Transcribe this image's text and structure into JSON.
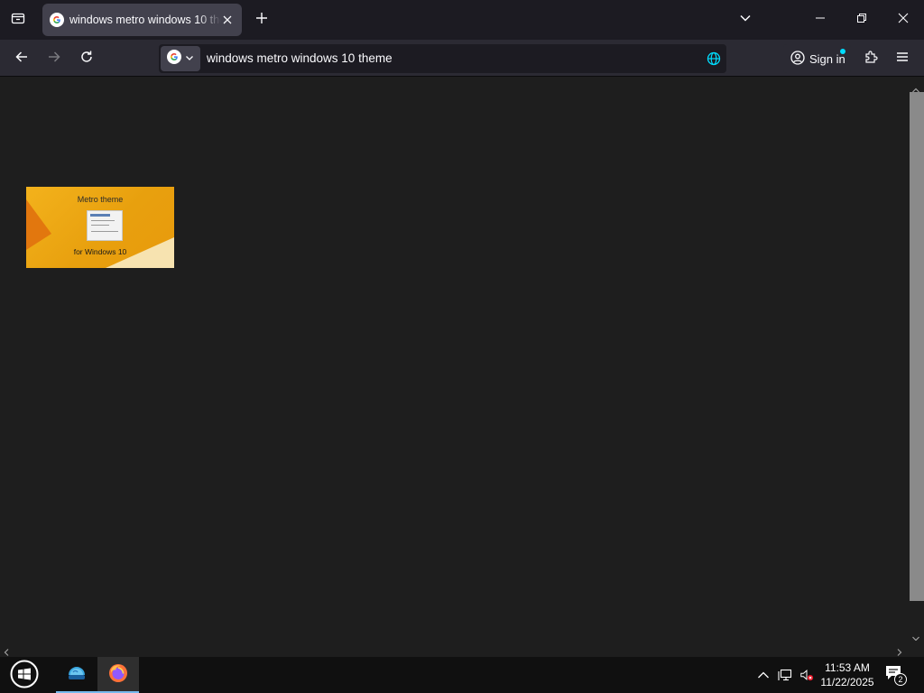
{
  "browser": {
    "tab": {
      "title": "windows metro windows 10 theme",
      "favicon": "google-g-icon"
    },
    "urlbar": {
      "value": "windows metro windows 10 theme",
      "search_engine": "google-g-icon"
    },
    "signin_label": "Sign in",
    "colors": {
      "tab_active": "#42414d",
      "toolbar": "#2b2a33",
      "urlbar": "#1c1b22",
      "accent": "#00ddff"
    }
  },
  "content": {
    "image_result": {
      "title": "Metro theme",
      "subtitle": "for Windows 10"
    },
    "background": "#1e1e1e"
  },
  "taskbar": {
    "clock_time": "11:53 AM",
    "clock_date": "11/22/2025",
    "notification_count": "2",
    "apps": [
      "earth-browser-icon",
      "firefox-icon"
    ]
  }
}
